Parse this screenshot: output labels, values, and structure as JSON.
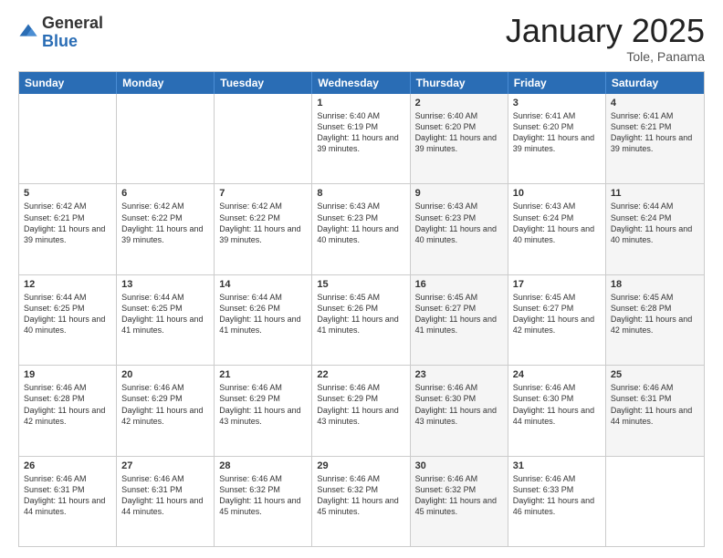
{
  "logo": {
    "general": "General",
    "blue": "Blue"
  },
  "title": "January 2025",
  "subtitle": "Tole, Panama",
  "days": [
    "Sunday",
    "Monday",
    "Tuesday",
    "Wednesday",
    "Thursday",
    "Friday",
    "Saturday"
  ],
  "rows": [
    [
      {
        "day": "",
        "text": "",
        "shaded": false
      },
      {
        "day": "",
        "text": "",
        "shaded": false
      },
      {
        "day": "",
        "text": "",
        "shaded": false
      },
      {
        "day": "1",
        "text": "Sunrise: 6:40 AM\nSunset: 6:19 PM\nDaylight: 11 hours and 39 minutes.",
        "shaded": false
      },
      {
        "day": "2",
        "text": "Sunrise: 6:40 AM\nSunset: 6:20 PM\nDaylight: 11 hours and 39 minutes.",
        "shaded": true
      },
      {
        "day": "3",
        "text": "Sunrise: 6:41 AM\nSunset: 6:20 PM\nDaylight: 11 hours and 39 minutes.",
        "shaded": false
      },
      {
        "day": "4",
        "text": "Sunrise: 6:41 AM\nSunset: 6:21 PM\nDaylight: 11 hours and 39 minutes.",
        "shaded": true
      }
    ],
    [
      {
        "day": "5",
        "text": "Sunrise: 6:42 AM\nSunset: 6:21 PM\nDaylight: 11 hours and 39 minutes.",
        "shaded": false
      },
      {
        "day": "6",
        "text": "Sunrise: 6:42 AM\nSunset: 6:22 PM\nDaylight: 11 hours and 39 minutes.",
        "shaded": false
      },
      {
        "day": "7",
        "text": "Sunrise: 6:42 AM\nSunset: 6:22 PM\nDaylight: 11 hours and 39 minutes.",
        "shaded": false
      },
      {
        "day": "8",
        "text": "Sunrise: 6:43 AM\nSunset: 6:23 PM\nDaylight: 11 hours and 40 minutes.",
        "shaded": false
      },
      {
        "day": "9",
        "text": "Sunrise: 6:43 AM\nSunset: 6:23 PM\nDaylight: 11 hours and 40 minutes.",
        "shaded": true
      },
      {
        "day": "10",
        "text": "Sunrise: 6:43 AM\nSunset: 6:24 PM\nDaylight: 11 hours and 40 minutes.",
        "shaded": false
      },
      {
        "day": "11",
        "text": "Sunrise: 6:44 AM\nSunset: 6:24 PM\nDaylight: 11 hours and 40 minutes.",
        "shaded": true
      }
    ],
    [
      {
        "day": "12",
        "text": "Sunrise: 6:44 AM\nSunset: 6:25 PM\nDaylight: 11 hours and 40 minutes.",
        "shaded": false
      },
      {
        "day": "13",
        "text": "Sunrise: 6:44 AM\nSunset: 6:25 PM\nDaylight: 11 hours and 41 minutes.",
        "shaded": false
      },
      {
        "day": "14",
        "text": "Sunrise: 6:44 AM\nSunset: 6:26 PM\nDaylight: 11 hours and 41 minutes.",
        "shaded": false
      },
      {
        "day": "15",
        "text": "Sunrise: 6:45 AM\nSunset: 6:26 PM\nDaylight: 11 hours and 41 minutes.",
        "shaded": false
      },
      {
        "day": "16",
        "text": "Sunrise: 6:45 AM\nSunset: 6:27 PM\nDaylight: 11 hours and 41 minutes.",
        "shaded": true
      },
      {
        "day": "17",
        "text": "Sunrise: 6:45 AM\nSunset: 6:27 PM\nDaylight: 11 hours and 42 minutes.",
        "shaded": false
      },
      {
        "day": "18",
        "text": "Sunrise: 6:45 AM\nSunset: 6:28 PM\nDaylight: 11 hours and 42 minutes.",
        "shaded": true
      }
    ],
    [
      {
        "day": "19",
        "text": "Sunrise: 6:46 AM\nSunset: 6:28 PM\nDaylight: 11 hours and 42 minutes.",
        "shaded": false
      },
      {
        "day": "20",
        "text": "Sunrise: 6:46 AM\nSunset: 6:29 PM\nDaylight: 11 hours and 42 minutes.",
        "shaded": false
      },
      {
        "day": "21",
        "text": "Sunrise: 6:46 AM\nSunset: 6:29 PM\nDaylight: 11 hours and 43 minutes.",
        "shaded": false
      },
      {
        "day": "22",
        "text": "Sunrise: 6:46 AM\nSunset: 6:29 PM\nDaylight: 11 hours and 43 minutes.",
        "shaded": false
      },
      {
        "day": "23",
        "text": "Sunrise: 6:46 AM\nSunset: 6:30 PM\nDaylight: 11 hours and 43 minutes.",
        "shaded": true
      },
      {
        "day": "24",
        "text": "Sunrise: 6:46 AM\nSunset: 6:30 PM\nDaylight: 11 hours and 44 minutes.",
        "shaded": false
      },
      {
        "day": "25",
        "text": "Sunrise: 6:46 AM\nSunset: 6:31 PM\nDaylight: 11 hours and 44 minutes.",
        "shaded": true
      }
    ],
    [
      {
        "day": "26",
        "text": "Sunrise: 6:46 AM\nSunset: 6:31 PM\nDaylight: 11 hours and 44 minutes.",
        "shaded": false
      },
      {
        "day": "27",
        "text": "Sunrise: 6:46 AM\nSunset: 6:31 PM\nDaylight: 11 hours and 44 minutes.",
        "shaded": false
      },
      {
        "day": "28",
        "text": "Sunrise: 6:46 AM\nSunset: 6:32 PM\nDaylight: 11 hours and 45 minutes.",
        "shaded": false
      },
      {
        "day": "29",
        "text": "Sunrise: 6:46 AM\nSunset: 6:32 PM\nDaylight: 11 hours and 45 minutes.",
        "shaded": false
      },
      {
        "day": "30",
        "text": "Sunrise: 6:46 AM\nSunset: 6:32 PM\nDaylight: 11 hours and 45 minutes.",
        "shaded": true
      },
      {
        "day": "31",
        "text": "Sunrise: 6:46 AM\nSunset: 6:33 PM\nDaylight: 11 hours and 46 minutes.",
        "shaded": false
      },
      {
        "day": "",
        "text": "",
        "shaded": false
      }
    ]
  ]
}
